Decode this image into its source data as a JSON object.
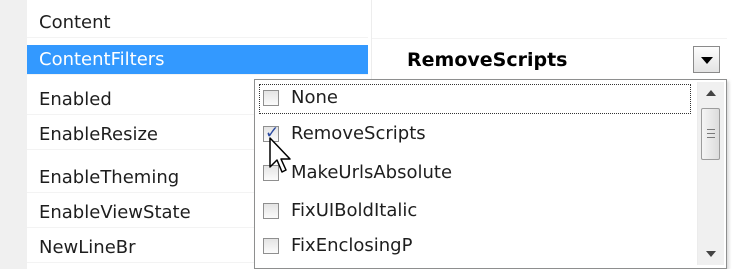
{
  "property_grid": {
    "rows": [
      {
        "name": "Content"
      },
      {
        "name": "ContentFilters"
      },
      {
        "name": "Enabled"
      },
      {
        "name": "EnableResize"
      },
      {
        "name": "EnableTheming"
      },
      {
        "name": "EnableViewState"
      },
      {
        "name": "NewLineBr"
      }
    ],
    "selected_row": "ContentFilters",
    "selected_value": "RemoveScripts"
  },
  "dropdown": {
    "options": [
      {
        "label": "None",
        "checked": false
      },
      {
        "label": "RemoveScripts",
        "checked": true
      },
      {
        "label": "MakeUrlsAbsolute",
        "checked": false
      },
      {
        "label": "FixUIBoldItalic",
        "checked": false
      },
      {
        "label": "FixEnclosingP",
        "checked": false
      }
    ],
    "focused_option": "None"
  },
  "icons": {
    "dropdown_arrow": "chevron-down-icon",
    "scroll_up": "arrow-up-icon",
    "scroll_down": "arrow-down-icon",
    "cursor": "mouse-pointer-icon",
    "check": "checkmark-icon"
  },
  "colors": {
    "selection": "#3399ff",
    "check": "#2a4aa0"
  }
}
